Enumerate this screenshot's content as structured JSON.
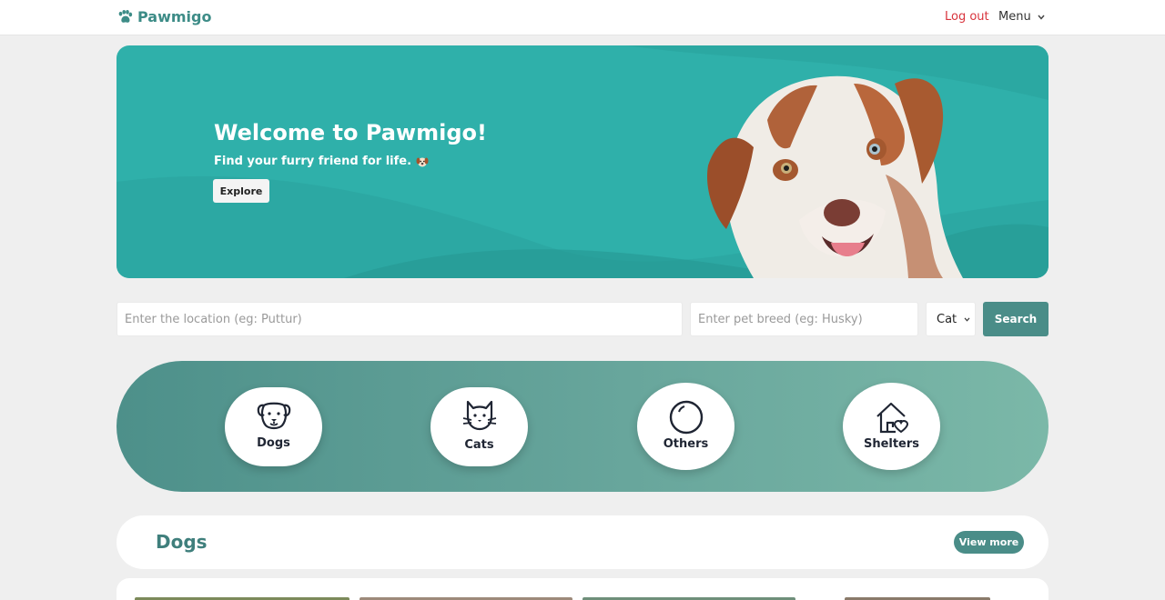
{
  "nav": {
    "brand": "Pawmigo",
    "logout": "Log out",
    "menu": "Menu"
  },
  "hero": {
    "title": "Welcome to Pawmigo!",
    "subtitle": "Find your furry friend for life.",
    "explore": "Explore"
  },
  "search": {
    "location_placeholder": "Enter the location (eg: Puttur)",
    "breed_placeholder": "Enter pet breed (eg: Husky)",
    "type_value": "Cat",
    "button": "Search"
  },
  "categories": [
    {
      "label": "Dogs",
      "icon": "dog-icon"
    },
    {
      "label": "Cats",
      "icon": "cat-icon"
    },
    {
      "label": "Others",
      "icon": "circle-icon"
    },
    {
      "label": "Shelters",
      "icon": "house-heart-icon"
    }
  ],
  "section": {
    "title": "Dogs",
    "view_more": "View more"
  },
  "colors": {
    "brand": "#3d8c87",
    "hero": "#2fb0aa",
    "accent": "#4a8d88",
    "logout": "#d8333c"
  }
}
